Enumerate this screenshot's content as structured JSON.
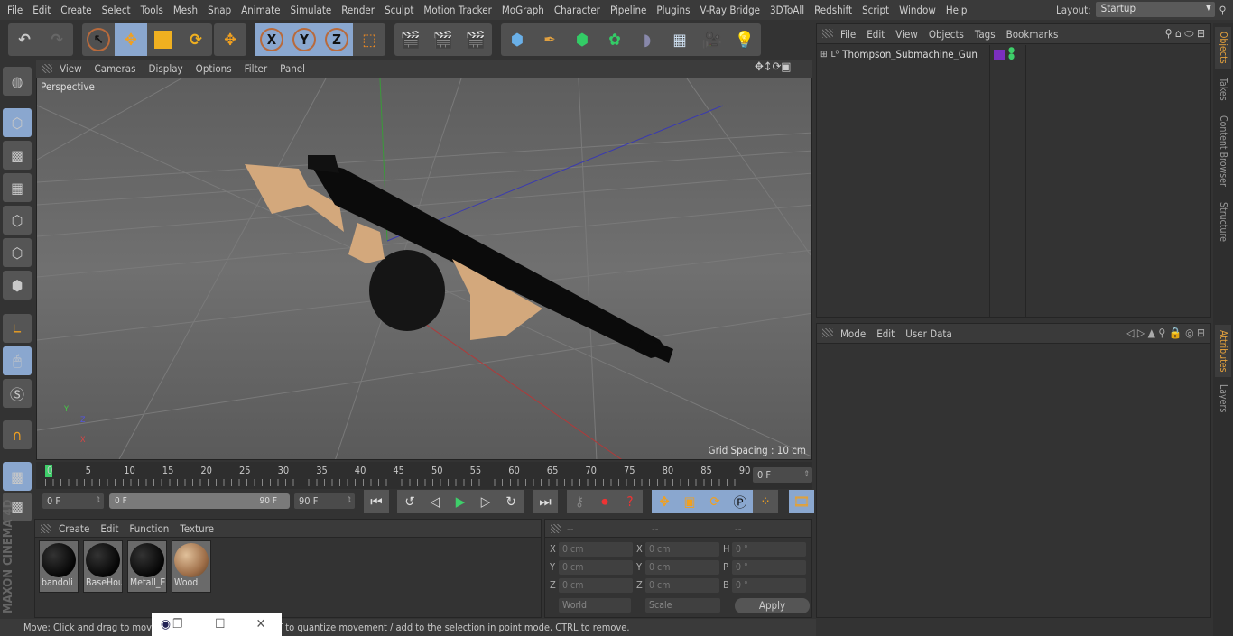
{
  "menu": [
    "File",
    "Edit",
    "Create",
    "Select",
    "Tools",
    "Mesh",
    "Snap",
    "Animate",
    "Simulate",
    "Render",
    "Sculpt",
    "Motion Tracker",
    "MoGraph",
    "Character",
    "Pipeline",
    "Plugins",
    "V-Ray Bridge",
    "3DToAll",
    "Redshift",
    "Script",
    "Window",
    "Help"
  ],
  "layout": {
    "label": "Layout:",
    "value": "Startup"
  },
  "viewport": {
    "menu": [
      "View",
      "Cameras",
      "Display",
      "Options",
      "Filter",
      "Panel"
    ],
    "camera": "Perspective",
    "grid_spacing": "Grid Spacing : 10 cm",
    "axis": {
      "x": "X",
      "y": "Y",
      "z": "Z"
    }
  },
  "timeline": {
    "ticks": [
      "0",
      "5",
      "10",
      "15",
      "20",
      "25",
      "30",
      "35",
      "40",
      "45",
      "50",
      "55",
      "60",
      "65",
      "70",
      "75",
      "80",
      "85",
      "90"
    ],
    "current": "0 F",
    "start": "0 F",
    "range_start": "0 F",
    "range_end": "90 F",
    "end": "90 F"
  },
  "materials": {
    "menu": [
      "Create",
      "Edit",
      "Function",
      "Texture"
    ],
    "items": [
      "bandoli",
      "BaseHou",
      "Metall_E",
      "Wood"
    ]
  },
  "coords": {
    "headers": [
      "--",
      "--",
      "--"
    ],
    "rows": [
      {
        "l1": "X",
        "v1": "0 cm",
        "l2": "X",
        "v2": "0 cm",
        "l3": "H",
        "v3": "0 °"
      },
      {
        "l1": "Y",
        "v1": "0 cm",
        "l2": "Y",
        "v2": "0 cm",
        "l3": "P",
        "v3": "0 °"
      },
      {
        "l1": "Z",
        "v1": "0 cm",
        "l2": "Z",
        "v2": "0 cm",
        "l3": "B",
        "v3": "0 °"
      }
    ],
    "mode": "World",
    "transform": "Scale",
    "apply": "Apply"
  },
  "status": "Move: Click and drag to move elements. Hold down SHIFT to quantize movement / add to the selection in point mode, CTRL to remove.",
  "objects": {
    "menu": [
      "File",
      "Edit",
      "View",
      "Objects",
      "Tags",
      "Bookmarks"
    ],
    "items": [
      {
        "name": "Thompson_Submachine_Gun",
        "layer_color": "#7b2fbf"
      }
    ]
  },
  "attributes": {
    "menu": [
      "Mode",
      "Edit",
      "User Data"
    ]
  },
  "right_tabs": [
    "Objects",
    "Takes",
    "Content Browser",
    "Structure",
    "Attributes",
    "Layers"
  ],
  "brand": "MAXON CINEMA 4D",
  "colors": {
    "accent": "#8aa7cf",
    "tab_active": "#e6a23c",
    "play": "#3ecf6a"
  }
}
